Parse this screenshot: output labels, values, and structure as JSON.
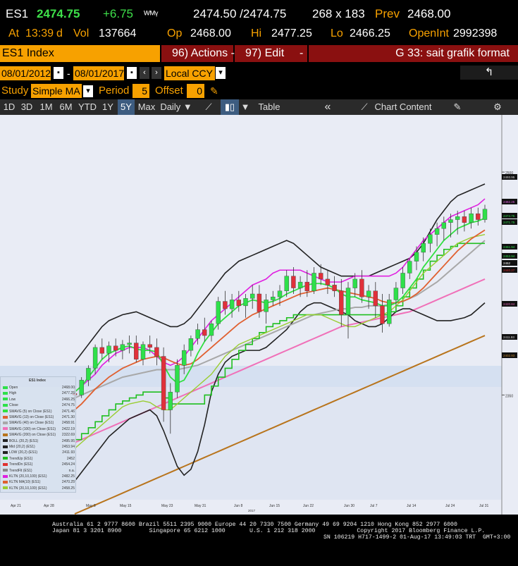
{
  "quote": {
    "ticker": "ES1",
    "last": "2474.75",
    "change": "+6.75",
    "bid_ask": "2474.50 /2474.75",
    "size": "268 x 183",
    "prev_label": "Prev",
    "prev": "2468.00",
    "at_label": "At",
    "time": "13:39",
    "time_suffix": "d",
    "vol_label": "Vol",
    "vol": "137664",
    "open_label": "Op",
    "open": "2468.00",
    "high_label": "Hi",
    "high": "2477.25",
    "low_label": "Lo",
    "low": "2466.25",
    "oi_label": "OpenInt",
    "open_interest": "2992398"
  },
  "toolbar1": {
    "security": "ES1 Index",
    "actions": "96) Actions -",
    "edit": "97) Edit",
    "edit_arrow": "-",
    "gfunc": "G 33: sait grafik format"
  },
  "toolbar2": {
    "start_date": "08/01/2012",
    "dash": "-",
    "end_date": "08/01/2017",
    "currency": "Local CCY",
    "back": "↰"
  },
  "toolbar3": {
    "study_label": "Study",
    "study_value": "Simple MA",
    "period_label": "Period",
    "period_value": "5",
    "offset_label": "Offset",
    "offset_value": "0"
  },
  "toolbar4": {
    "ranges": [
      "1D",
      "3D",
      "1M",
      "6M",
      "YTD",
      "1Y",
      "5Y",
      "Max"
    ],
    "selected_range": "5Y",
    "frequency": "Daily ▼",
    "table": "Table",
    "collapse": "«",
    "chart_content": "Chart Content"
  },
  "colors": {
    "bloomberg_orange": "#f7a100",
    "up_candle": "#2ee04a",
    "down_candle": "#e0303a",
    "chart_bg": "#e9ecf5",
    "band_shade": "#dbe5f4"
  },
  "chart_data": {
    "type": "candlestick",
    "y_axis_ticks": [
      "2500",
      "2350"
    ],
    "right_labels": [
      "2493.95",
      "2482.25",
      "2474.75",
      "2471.75",
      "2461.94",
      "2453.94",
      "2452",
      "2440.27",
      "2420.84",
      "2411.93",
      "2402.93"
    ],
    "x_axis_ticks": [
      "Apr 21",
      "Apr 28",
      "May 8",
      "May 15",
      "May 23",
      "May 31",
      "Jun 8",
      "Jun 15",
      "Jun 22",
      "Jun 30",
      "Jul 7",
      "Jul 14",
      "Jul 24",
      "Jul 31"
    ],
    "x_axis_year": "2017",
    "legend_title": "ES1 Index",
    "legend": [
      {
        "name": "Open",
        "value": "2468.00"
      },
      {
        "name": "High",
        "value": "2477.25"
      },
      {
        "name": "Low",
        "value": "2466.25"
      },
      {
        "name": "Close",
        "value": "2474.75"
      },
      {
        "name": "SMAVG (5) on Close (ES1)",
        "value": "2471.46"
      },
      {
        "name": "SMAVG (13) on Close (ES1)",
        "value": "2471.30"
      },
      {
        "name": "SMAVG (40) on Close (ES1)",
        "value": "2458.91"
      },
      {
        "name": "SMAVG (100) on Close (ES1)",
        "value": "2422.19"
      },
      {
        "name": "SMAVG (200) on Close (ES1)",
        "value": "2322.69"
      },
      {
        "name": "BOLL (20,2) (ES1)",
        "value": "2495.95"
      },
      {
        "name": "Mid (20,2) (ES1)",
        "value": "2453.94"
      },
      {
        "name": "LOW (20,2) (ES1)",
        "value": "2411.93"
      },
      {
        "name": "TrendUp (ES1)",
        "value": "2452"
      },
      {
        "name": "TrendDn (ES1)",
        "value": "2454.24"
      },
      {
        "name": "TrendFlt (ES1)",
        "value": "n.a."
      },
      {
        "name": "KLTN (20,10,100) (ES1)",
        "value": "2482.25"
      },
      {
        "name": "KLTN MA(10) (ES1)",
        "value": "2470.25"
      },
      {
        "name": "KLTN (20,10,100) (ES1)",
        "value": "2458.25"
      }
    ],
    "candles": [
      {
        "o": 2351,
        "h": 2356,
        "l": 2345,
        "c": 2350
      },
      {
        "o": 2350,
        "h": 2362,
        "l": 2348,
        "c": 2360
      },
      {
        "o": 2360,
        "h": 2370,
        "l": 2356,
        "c": 2368
      },
      {
        "o": 2368,
        "h": 2384,
        "l": 2364,
        "c": 2382
      },
      {
        "o": 2382,
        "h": 2388,
        "l": 2374,
        "c": 2378
      },
      {
        "o": 2378,
        "h": 2386,
        "l": 2372,
        "c": 2383
      },
      {
        "o": 2383,
        "h": 2388,
        "l": 2376,
        "c": 2380
      },
      {
        "o": 2380,
        "h": 2387,
        "l": 2374,
        "c": 2384
      },
      {
        "o": 2384,
        "h": 2390,
        "l": 2378,
        "c": 2385
      },
      {
        "o": 2385,
        "h": 2390,
        "l": 2372,
        "c": 2374
      },
      {
        "o": 2374,
        "h": 2386,
        "l": 2370,
        "c": 2384
      },
      {
        "o": 2384,
        "h": 2390,
        "l": 2378,
        "c": 2382
      },
      {
        "o": 2382,
        "h": 2388,
        "l": 2370,
        "c": 2376
      },
      {
        "o": 2376,
        "h": 2382,
        "l": 2332,
        "c": 2340
      },
      {
        "o": 2340,
        "h": 2358,
        "l": 2324,
        "c": 2352
      },
      {
        "o": 2352,
        "h": 2374,
        "l": 2348,
        "c": 2370
      },
      {
        "o": 2370,
        "h": 2384,
        "l": 2364,
        "c": 2380
      },
      {
        "o": 2380,
        "h": 2390,
        "l": 2376,
        "c": 2388
      },
      {
        "o": 2388,
        "h": 2398,
        "l": 2384,
        "c": 2394
      },
      {
        "o": 2394,
        "h": 2402,
        "l": 2386,
        "c": 2390
      },
      {
        "o": 2390,
        "h": 2400,
        "l": 2386,
        "c": 2398
      },
      {
        "o": 2398,
        "h": 2416,
        "l": 2394,
        "c": 2413
      },
      {
        "o": 2413,
        "h": 2420,
        "l": 2404,
        "c": 2408
      },
      {
        "o": 2408,
        "h": 2418,
        "l": 2402,
        "c": 2414
      },
      {
        "o": 2414,
        "h": 2420,
        "l": 2406,
        "c": 2410
      },
      {
        "o": 2410,
        "h": 2418,
        "l": 2402,
        "c": 2415
      },
      {
        "o": 2415,
        "h": 2424,
        "l": 2408,
        "c": 2418
      },
      {
        "o": 2418,
        "h": 2424,
        "l": 2402,
        "c": 2406
      },
      {
        "o": 2406,
        "h": 2418,
        "l": 2398,
        "c": 2414
      },
      {
        "o": 2414,
        "h": 2420,
        "l": 2410,
        "c": 2416
      },
      {
        "o": 2416,
        "h": 2424,
        "l": 2410,
        "c": 2420
      },
      {
        "o": 2420,
        "h": 2434,
        "l": 2416,
        "c": 2430
      },
      {
        "o": 2430,
        "h": 2436,
        "l": 2418,
        "c": 2422
      },
      {
        "o": 2422,
        "h": 2430,
        "l": 2416,
        "c": 2426
      },
      {
        "o": 2426,
        "h": 2434,
        "l": 2416,
        "c": 2420
      },
      {
        "o": 2420,
        "h": 2436,
        "l": 2418,
        "c": 2432
      },
      {
        "o": 2432,
        "h": 2438,
        "l": 2424,
        "c": 2428
      },
      {
        "o": 2428,
        "h": 2434,
        "l": 2418,
        "c": 2424
      },
      {
        "o": 2424,
        "h": 2430,
        "l": 2416,
        "c": 2420
      },
      {
        "o": 2420,
        "h": 2428,
        "l": 2396,
        "c": 2404
      },
      {
        "o": 2404,
        "h": 2426,
        "l": 2388,
        "c": 2422
      },
      {
        "o": 2422,
        "h": 2432,
        "l": 2416,
        "c": 2428
      },
      {
        "o": 2428,
        "h": 2434,
        "l": 2412,
        "c": 2416
      },
      {
        "o": 2416,
        "h": 2424,
        "l": 2408,
        "c": 2420
      },
      {
        "o": 2420,
        "h": 2426,
        "l": 2402,
        "c": 2410
      },
      {
        "o": 2410,
        "h": 2418,
        "l": 2392,
        "c": 2398
      },
      {
        "o": 2398,
        "h": 2418,
        "l": 2396,
        "c": 2414
      },
      {
        "o": 2414,
        "h": 2426,
        "l": 2410,
        "c": 2422
      },
      {
        "o": 2422,
        "h": 2436,
        "l": 2418,
        "c": 2432
      },
      {
        "o": 2432,
        "h": 2442,
        "l": 2428,
        "c": 2440
      },
      {
        "o": 2440,
        "h": 2450,
        "l": 2434,
        "c": 2446
      },
      {
        "o": 2446,
        "h": 2456,
        "l": 2440,
        "c": 2452
      },
      {
        "o": 2452,
        "h": 2462,
        "l": 2446,
        "c": 2458
      },
      {
        "o": 2458,
        "h": 2466,
        "l": 2450,
        "c": 2462
      },
      {
        "o": 2462,
        "h": 2470,
        "l": 2454,
        "c": 2466
      },
      {
        "o": 2466,
        "h": 2472,
        "l": 2456,
        "c": 2468
      },
      {
        "o": 2468,
        "h": 2474,
        "l": 2458,
        "c": 2470
      },
      {
        "o": 2470,
        "h": 2474,
        "l": 2460,
        "c": 2466
      },
      {
        "o": 2466,
        "h": 2476,
        "l": 2462,
        "c": 2472
      },
      {
        "o": 2472,
        "h": 2476,
        "l": 2464,
        "c": 2468
      },
      {
        "o": 2468,
        "h": 2478,
        "l": 2466,
        "c": 2475
      }
    ],
    "sma5": [
      2352,
      2356,
      2362,
      2368,
      2374,
      2378,
      2380,
      2382,
      2383,
      2381,
      2380,
      2380,
      2379,
      2370,
      2362,
      2358,
      2360,
      2368,
      2378,
      2386,
      2392,
      2398,
      2402,
      2406,
      2410,
      2412,
      2414,
      2413,
      2412,
      2413,
      2415,
      2418,
      2420,
      2422,
      2424,
      2425,
      2425,
      2424,
      2422,
      2418,
      2416,
      2416,
      2414,
      2413,
      2412,
      2410,
      2410,
      2412,
      2416,
      2422,
      2428,
      2436,
      2442,
      2448,
      2454,
      2458,
      2462,
      2464,
      2466,
      2467,
      2469
    ],
    "sma13": [
      2340,
      2344,
      2349,
      2354,
      2358,
      2362,
      2365,
      2368,
      2370,
      2372,
      2374,
      2375,
      2376,
      2375,
      2373,
      2371,
      2370,
      2371,
      2374,
      2378,
      2382,
      2386,
      2390,
      2394,
      2398,
      2401,
      2404,
      2406,
      2408,
      2410,
      2412,
      2414,
      2416,
      2418,
      2419,
      2420,
      2421,
      2422,
      2421,
      2420,
      2419,
      2418,
      2417,
      2416,
      2415,
      2413,
      2412,
      2412,
      2413,
      2415,
      2418,
      2422,
      2427,
      2432,
      2437,
      2442,
      2447,
      2451,
      2455,
      2458,
      2461
    ],
    "sma40": [
      2348,
      2350,
      2352,
      2354,
      2356,
      2358,
      2360,
      2362,
      2363,
      2364,
      2365,
      2366,
      2367,
      2367,
      2367,
      2367,
      2368,
      2369,
      2370,
      2372,
      2374,
      2376,
      2378,
      2380,
      2382,
      2384,
      2386,
      2388,
      2390,
      2392,
      2394,
      2396,
      2398,
      2400,
      2402,
      2404,
      2405,
      2406,
      2407,
      2408,
      2408,
      2409,
      2409,
      2410,
      2410,
      2410,
      2411,
      2412,
      2413,
      2415,
      2417,
      2420,
      2423,
      2426,
      2430,
      2434,
      2438,
      2442,
      2446,
      2450,
      2454
    ],
    "sma100": [
      2318,
      2320,
      2322,
      2324,
      2326,
      2328,
      2330,
      2332,
      2334,
      2336,
      2338,
      2340,
      2342,
      2344,
      2346,
      2348,
      2350,
      2352,
      2354,
      2356,
      2358,
      2360,
      2362,
      2364,
      2366,
      2368,
      2370,
      2372,
      2374,
      2376,
      2378,
      2380,
      2382,
      2384,
      2386,
      2388,
      2390,
      2392,
      2394,
      2396,
      2397,
      2398,
      2399,
      2400,
      2401,
      2402,
      2403,
      2404,
      2405,
      2406,
      2408,
      2410,
      2412,
      2414,
      2416,
      2418,
      2420,
      2422,
      2424,
      2426,
      2428
    ],
    "sma200": [
      2270,
      2272,
      2274,
      2276,
      2278,
      2280,
      2282,
      2284,
      2286,
      2288,
      2290,
      2292,
      2294,
      2296,
      2298,
      2300,
      2302,
      2304,
      2306,
      2308,
      2310,
      2312,
      2314,
      2316,
      2318,
      2320,
      2322,
      2324,
      2326,
      2328,
      2330,
      2332,
      2334,
      2336,
      2338,
      2340,
      2342,
      2344,
      2346,
      2348,
      2350,
      2352,
      2354,
      2356,
      2358,
      2360,
      2362,
      2364,
      2366,
      2368,
      2370,
      2372,
      2374,
      2376,
      2378,
      2380,
      2382,
      2384,
      2386,
      2388,
      2390
    ],
    "boll_up": [
      2372,
      2378,
      2384,
      2390,
      2396,
      2400,
      2402,
      2404,
      2405,
      2406,
      2404,
      2402,
      2400,
      2398,
      2396,
      2396,
      2398,
      2402,
      2408,
      2414,
      2420,
      2426,
      2432,
      2436,
      2440,
      2442,
      2444,
      2446,
      2448,
      2450,
      2452,
      2454,
      2452,
      2448,
      2444,
      2440,
      2436,
      2434,
      2432,
      2430,
      2430,
      2430,
      2430,
      2430,
      2432,
      2434,
      2436,
      2438,
      2440,
      2442,
      2446,
      2452,
      2460,
      2468,
      2474,
      2480,
      2484,
      2486,
      2488,
      2490,
      2492
    ],
    "boll_lo": [
      2292,
      2298,
      2304,
      2310,
      2316,
      2322,
      2326,
      2330,
      2334,
      2336,
      2338,
      2340,
      2336,
      2326,
      2314,
      2302,
      2296,
      2300,
      2312,
      2330,
      2352,
      2364,
      2372,
      2376,
      2378,
      2380,
      2380,
      2380,
      2382,
      2386,
      2390,
      2394,
      2400,
      2406,
      2410,
      2412,
      2412,
      2410,
      2408,
      2406,
      2404,
      2400,
      2398,
      2396,
      2396,
      2398,
      2402,
      2406,
      2408,
      2408,
      2406,
      2404,
      2402,
      2400,
      2400,
      2400,
      2401,
      2402,
      2404,
      2408,
      2412
    ],
    "kltn_up": [
      2352,
      2356,
      2360,
      2364,
      2370,
      2374,
      2378,
      2380,
      2382,
      2382,
      2382,
      2380,
      2376,
      2372,
      2370,
      2372,
      2376,
      2382,
      2388,
      2394,
      2400,
      2404,
      2408,
      2412,
      2416,
      2420,
      2424,
      2426,
      2428,
      2432,
      2434,
      2434,
      2434,
      2434,
      2432,
      2430,
      2428,
      2426,
      2426,
      2426,
      2428,
      2430,
      2430,
      2430,
      2430,
      2430,
      2430,
      2432,
      2436,
      2442,
      2448,
      2454,
      2458,
      2462,
      2466,
      2470,
      2472,
      2474,
      2476,
      2478,
      2482
    ],
    "kltn_lo": [
      2314,
      2318,
      2322,
      2326,
      2330,
      2334,
      2338,
      2342,
      2344,
      2345,
      2346,
      2345,
      2342,
      2340,
      2340,
      2344,
      2348,
      2352,
      2356,
      2360,
      2364,
      2370,
      2376,
      2380,
      2384,
      2386,
      2388,
      2390,
      2392,
      2394,
      2396,
      2398,
      2400,
      2402,
      2404,
      2404,
      2404,
      2402,
      2400,
      2398,
      2396,
      2396,
      2398,
      2400,
      2402,
      2404,
      2406,
      2410,
      2414,
      2420,
      2426,
      2432,
      2436,
      2440,
      2444,
      2448,
      2452,
      2454,
      2456,
      2457,
      2458
    ],
    "trend_up": [
      2320,
      2324,
      2328,
      2332,
      2336,
      2340,
      2344,
      2346,
      2348,
      2350,
      2352,
      2352,
      2352,
      2348,
      2344,
      2344,
      2344,
      2344,
      2344,
      2350,
      2356,
      2362,
      2368,
      2374,
      2380,
      2384,
      2388,
      2392,
      2396,
      2398,
      2400,
      2402,
      2404,
      2404,
      2404,
      2404,
      2404,
      2404,
      2404,
      2404,
      2404,
      2404,
      2404,
      2404,
      2404,
      2404,
      2406,
      2410,
      2416,
      2422,
      2428,
      2434,
      2440,
      2444,
      2448,
      2450,
      2452,
      2452,
      2452,
      2452,
      2452
    ]
  },
  "footer": {
    "line1": "Australia 61 2 9777 8600 Brazil 5511 2395 9000 Europe 44 20 7330 7500 Germany 49 69 9204 1210 Hong Kong 852 2977 6000",
    "line2": "Japan 81 3 3201 8900        Singapore 65 6212 1000       U.S. 1 212 318 2000            Copyright 2017 Bloomberg Finance L.P.",
    "line3": "SN 106219 H717-1499-2 01-Aug-17 13:49:03 TRT  GMT+3:00"
  }
}
